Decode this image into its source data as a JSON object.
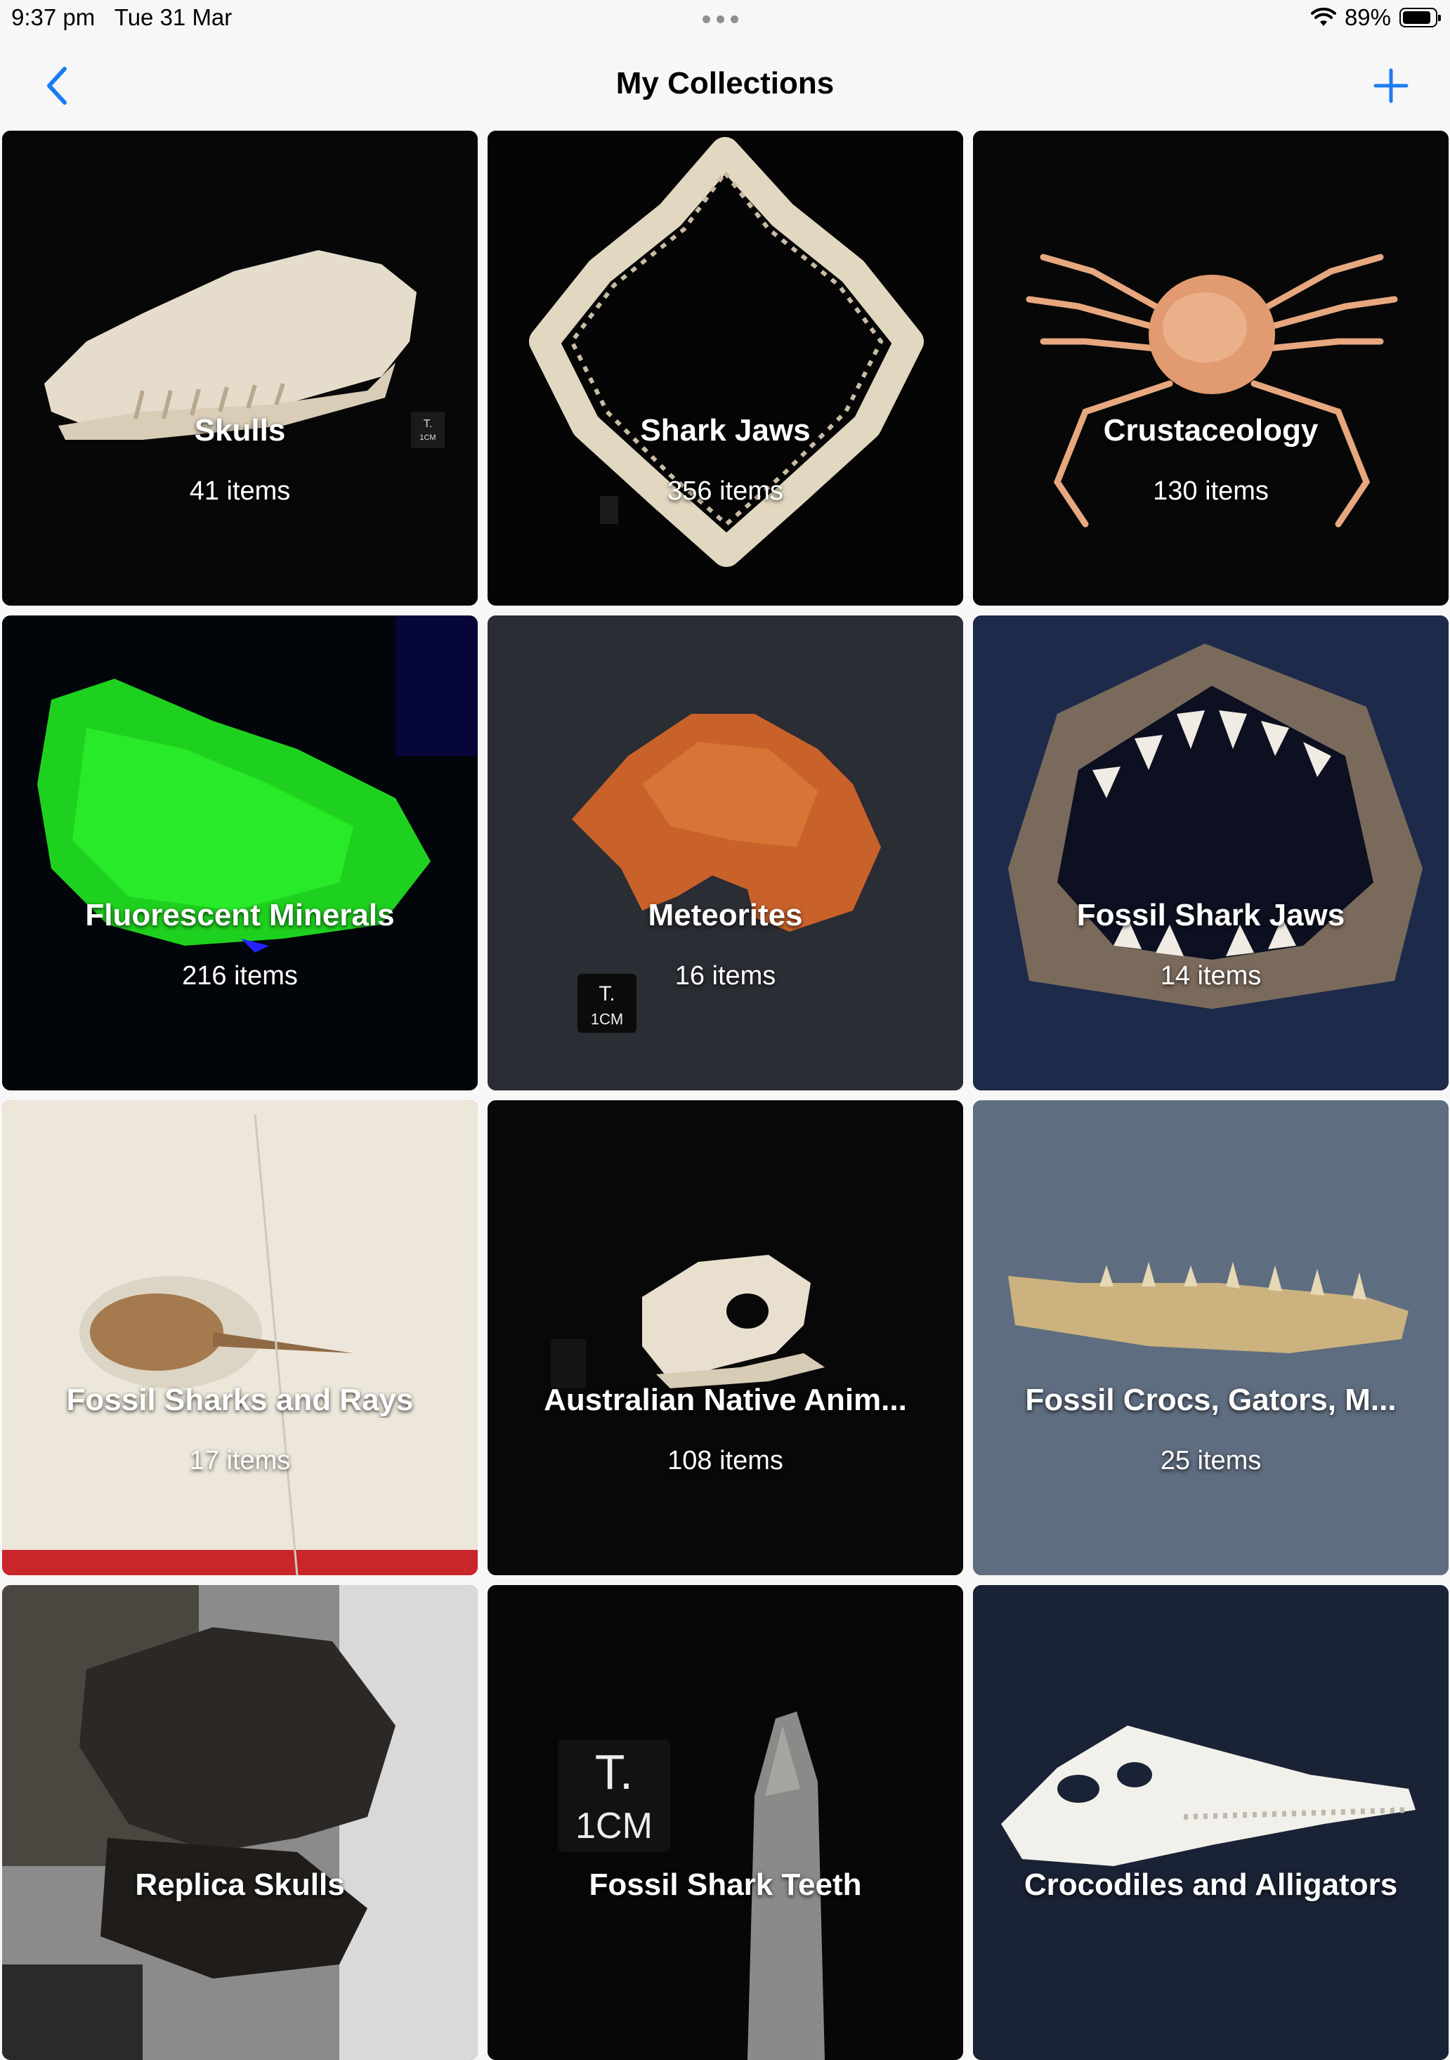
{
  "status": {
    "time": "9:37 pm",
    "date": "Tue 31 Mar",
    "battery": "89%",
    "battery_level": 0.89
  },
  "nav": {
    "title": "My Collections",
    "back_icon": "chevron-left-icon",
    "add_icon": "plus-icon",
    "accent": "#1a7cf2"
  },
  "collections": [
    {
      "title": "Skulls",
      "count": "41 items",
      "image": "snake-skull"
    },
    {
      "title": "Shark Jaws",
      "count": "356 items",
      "image": "shark-jaw"
    },
    {
      "title": "Crustaceology",
      "count": "130 items",
      "image": "crab"
    },
    {
      "title": "Fluorescent Minerals",
      "count": "216 items",
      "image": "fluorescent-mineral"
    },
    {
      "title": "Meteorites",
      "count": "16 items",
      "image": "meteorite"
    },
    {
      "title": "Fossil Shark Jaws",
      "count": "14 items",
      "image": "fossil-shark-jaw"
    },
    {
      "title": "Fossil Sharks and Rays",
      "count": "17 items",
      "image": "fossil-ray-slab"
    },
    {
      "title": "Australian Native Anim...",
      "count": "108 items",
      "image": "small-skull"
    },
    {
      "title": "Fossil Crocs, Gators, M...",
      "count": "25 items",
      "image": "croc-jaw-fragment"
    },
    {
      "title": "Replica Skulls",
      "count": "",
      "image": "dinosaur-skull"
    },
    {
      "title": "Fossil Shark Teeth",
      "count": "",
      "image": "shark-tooth"
    },
    {
      "title": "Crocodiles and Alligators",
      "count": "",
      "image": "croc-skull"
    }
  ]
}
